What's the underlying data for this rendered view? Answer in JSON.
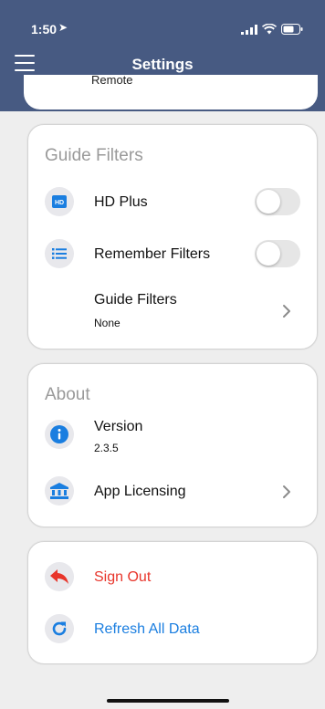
{
  "status_bar": {
    "time": "1:50"
  },
  "nav": {
    "title": "Settings"
  },
  "previous_card": {
    "partial_text": "Remote"
  },
  "guide_filters": {
    "title": "Guide Filters",
    "hd_plus": {
      "label": "HD Plus",
      "on": false,
      "icon": "hd-icon"
    },
    "remember_filters": {
      "label": "Remember Filters",
      "on": false,
      "icon": "list-icon"
    },
    "guide_filters_row": {
      "label": "Guide Filters",
      "value": "None"
    }
  },
  "about": {
    "title": "About",
    "version": {
      "label": "Version",
      "value": "2.3.5",
      "icon": "info-icon"
    },
    "app_licensing": {
      "label": "App Licensing",
      "icon": "bank-icon"
    }
  },
  "actions": {
    "sign_out": {
      "label": "Sign Out",
      "icon": "reply-arrow-icon",
      "color": "#e8352b"
    },
    "refresh": {
      "label": "Refresh All Data",
      "icon": "refresh-icon",
      "color": "#1a7ee0"
    }
  },
  "colors": {
    "header": "#475a82",
    "blue_icon": "#1a7ee0",
    "red_icon": "#e8352b"
  }
}
